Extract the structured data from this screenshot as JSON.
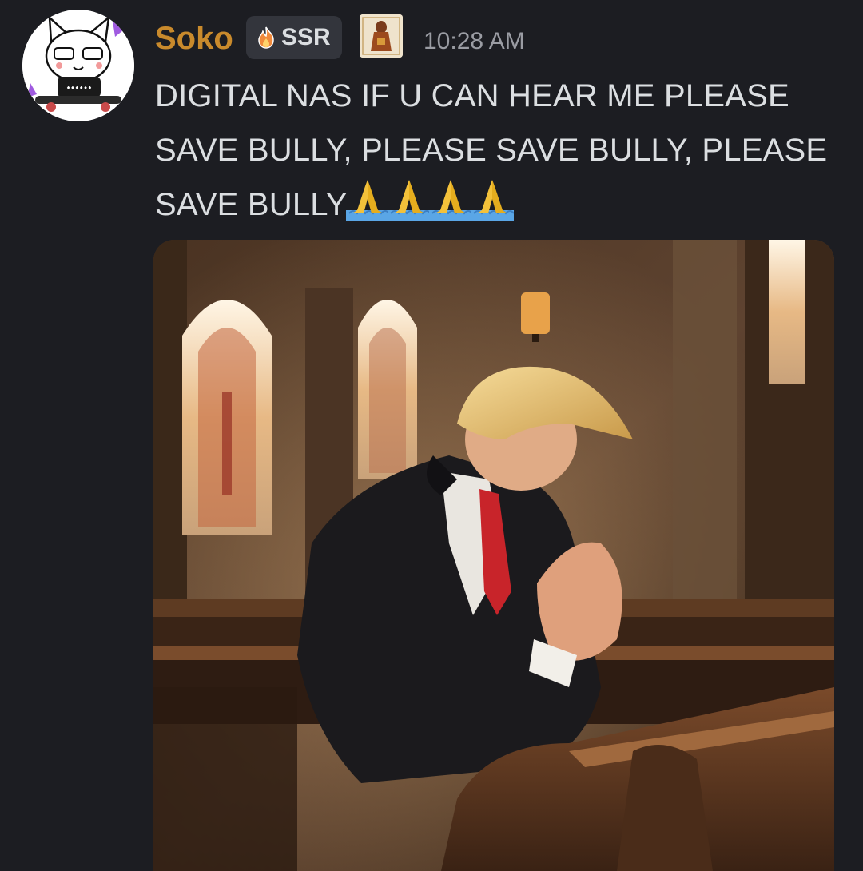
{
  "message": {
    "author": "Soko",
    "tag": {
      "icon": "fire-icon",
      "label": "SSR"
    },
    "role_icon": "album-cover-icon",
    "timestamp": "10:28 AM",
    "text": "DIGITAL NAS IF U CAN HEAR ME PLEASE SAVE BULLY, PLEASE SAVE BULLY, PLEASE SAVE BULLY",
    "emojis": [
      "folded-hands-icon",
      "folded-hands-icon",
      "folded-hands-icon",
      "folded-hands-icon"
    ],
    "attachment": {
      "kind": "image",
      "subject": "man-praying-in-church"
    }
  },
  "colors": {
    "background": "#1c1d22",
    "author": "#c98a2c",
    "text": "#dbdee1",
    "timestamp": "#9a9ca3",
    "tag_bg": "#33353c"
  }
}
